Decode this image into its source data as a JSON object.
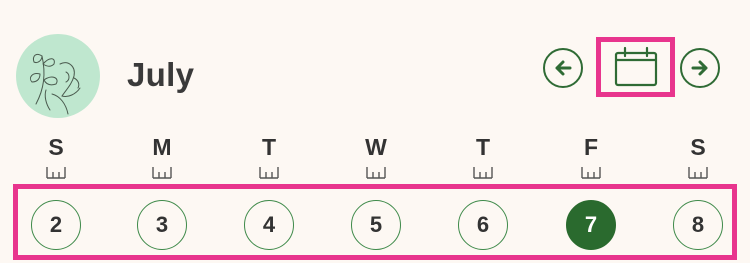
{
  "header": {
    "month": "July",
    "avatar_icon": "floral-line-art-icon",
    "prev_icon": "arrow-left-icon",
    "next_icon": "arrow-right-icon",
    "calendar_icon": "calendar-icon"
  },
  "week": {
    "days_of_week": [
      "S",
      "M",
      "T",
      "W",
      "T",
      "F",
      "S"
    ],
    "dates": [
      "2",
      "3",
      "4",
      "5",
      "6",
      "7",
      "8"
    ],
    "selected_index": 5
  },
  "colors": {
    "accent_green": "#2a6a2e",
    "highlight_pink": "#e8358d",
    "background": "#fdf8f3",
    "avatar_bg": "#bfe7cf"
  }
}
